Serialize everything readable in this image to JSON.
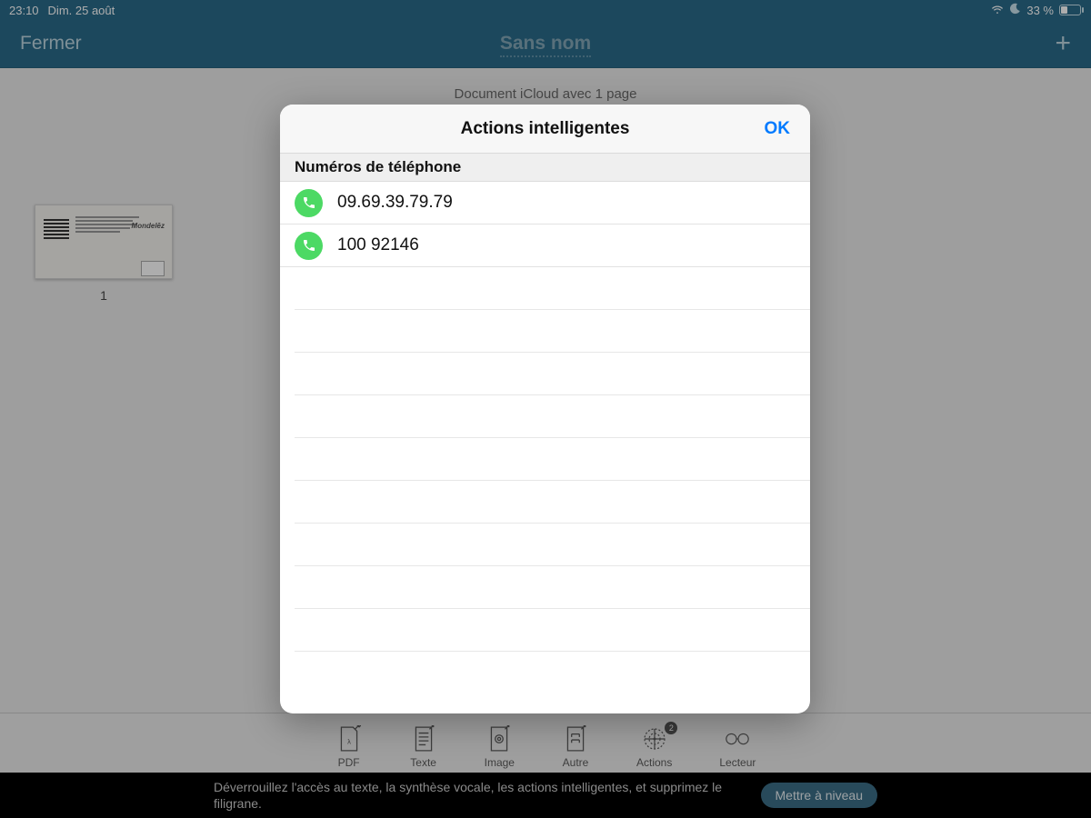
{
  "status": {
    "time": "23:10",
    "date": "Dim. 25 août",
    "battery_pct": "33 %"
  },
  "nav": {
    "close": "Fermer",
    "title": "Sans nom",
    "add_label": "+"
  },
  "subtitle": "Document iCloud avec 1 page",
  "thumbnail": {
    "page_num": "1",
    "brand_text": "Mondelēz"
  },
  "toolbar": {
    "items": [
      {
        "label": "PDF"
      },
      {
        "label": "Texte"
      },
      {
        "label": "Image"
      },
      {
        "label": "Autre"
      },
      {
        "label": "Actions",
        "badge": "2"
      },
      {
        "label": "Lecteur"
      }
    ]
  },
  "banner": {
    "message": "Déverrouillez l'accès au texte, la synthèse vocale, les actions intelligentes, et supprimez le filigrane.",
    "upgrade": "Mettre à niveau"
  },
  "modal": {
    "title": "Actions intelligentes",
    "ok": "OK",
    "section": "Numéros de téléphone",
    "phones": [
      "09.69.39.79.79",
      "100 92146"
    ]
  }
}
